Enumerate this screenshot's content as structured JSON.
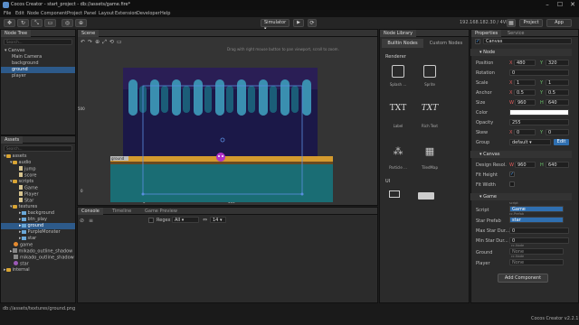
{
  "window": {
    "title": "Cocos Creator - start_project - db://assets/game.fire*",
    "min": "–",
    "max": "☐",
    "close": "✕"
  },
  "menu": [
    "File",
    "Edit",
    "Node",
    "Component",
    "Project",
    "Panel",
    "Layout",
    "Extension",
    "Developer",
    "Help"
  ],
  "toolbar": {
    "simulator": "Simulator",
    "ip": "192.168.182.30 / 4VIE",
    "project_btn": "Project",
    "app_btn": "App"
  },
  "node_tree": {
    "tab": "Node Tree",
    "search_placeholder": "Search...",
    "items": [
      "Canvas",
      "Main Camera",
      "background",
      "ground",
      "player"
    ]
  },
  "assets": {
    "tab": "Assets",
    "search_placeholder": "Search...",
    "items": [
      "assets",
      "audio",
      "jump",
      "score",
      "scripts",
      "Game",
      "Player",
      "Star",
      "textures",
      "background",
      "btn_play",
      "ground",
      "PurpleMonster",
      "star",
      "game",
      "mikado_outline_shadow",
      "mikado_outline_shadow",
      "star",
      "internal"
    ],
    "status": "db://assets/textures/ground.png"
  },
  "scene": {
    "tab": "Scene",
    "hint": "Drag with right mouse button to pan viewport, scroll to zoom.",
    "axis_500": "500",
    "axis_0": "0",
    "axis_bottom_0": "0",
    "axis_bottom_500": "500",
    "ground_label": "ground",
    "buttons": [
      "↶",
      "↷",
      "⊕",
      "⤢",
      "⟲",
      "▭"
    ]
  },
  "bottom_panel": {
    "tabs": [
      "Console",
      "Timeline",
      "Game Preview"
    ],
    "regex_label": "Regex",
    "filter_all": "All",
    "count": "14"
  },
  "node_library": {
    "tab": "Node Library",
    "sub_tabs": [
      "Builtin Nodes",
      "Custom Nodes"
    ],
    "section_renderer": "Renderer",
    "section_ui": "UI",
    "items": [
      {
        "label": "Splash ...",
        "glyph": "⊡"
      },
      {
        "label": "Sprite",
        "glyph": "⊡"
      },
      {
        "label": "Label",
        "glyph": "TXT"
      },
      {
        "label": "Rich Text",
        "glyph": "TXT"
      },
      {
        "label": "Particle ...",
        "glyph": "⁂"
      },
      {
        "label": "TiledMap",
        "glyph": "▦"
      }
    ]
  },
  "properties": {
    "tab": "Properties",
    "tab2": "Service",
    "node_name": "Canvas",
    "node_section": "Node",
    "position": {
      "label": "Position",
      "x": "480",
      "y": "320"
    },
    "rotation": {
      "label": "Rotation",
      "v": "0"
    },
    "scale": {
      "label": "Scale",
      "x": "1",
      "y": "1"
    },
    "anchor": {
      "label": "Anchor",
      "x": "0.5",
      "y": "0.5"
    },
    "size": {
      "label": "Size",
      "w": "960",
      "h": "640"
    },
    "color": {
      "label": "Color"
    },
    "opacity": {
      "label": "Opacity",
      "v": "255"
    },
    "skew": {
      "label": "Skew",
      "x": "0",
      "y": "0"
    },
    "group": {
      "label": "Group",
      "v": "default",
      "edit": "Edit"
    },
    "canvas_section": "Canvas",
    "design": {
      "label": "Design Resol.",
      "w": "960",
      "h": "640"
    },
    "fit_height": "Fit Height",
    "fit_width": "Fit Width",
    "game_section": "Game",
    "script": {
      "label": "Script",
      "tag": "script",
      "v": "Game"
    },
    "star_prefab": {
      "label": "Star Prefab",
      "tag": "cc.Prefab",
      "v": "star"
    },
    "max_star": {
      "label": "Max Star Dur...",
      "v": "0"
    },
    "min_star": {
      "label": "Min Star Dur...",
      "v": "0"
    },
    "ground": {
      "label": "Ground",
      "tag": "cc.Node",
      "v": "None"
    },
    "player": {
      "label": "Player",
      "tag": "cc.Node",
      "v": "None"
    },
    "add_component": "Add Component"
  },
  "status": {
    "version": "Cocos Creator v2.2.1"
  }
}
